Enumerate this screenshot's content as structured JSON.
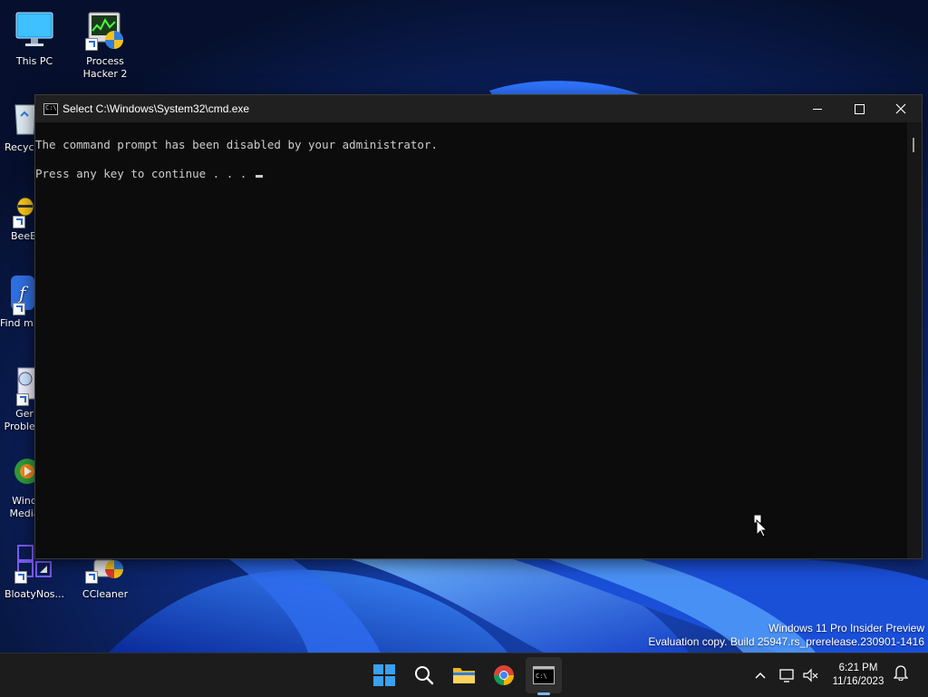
{
  "desktop": {
    "icons": [
      {
        "label": "This PC"
      },
      {
        "label": "Process Hacker 2"
      },
      {
        "label": "Recyc"
      },
      {
        "label": "BeeE"
      },
      {
        "label": "Find m"
      },
      {
        "label": "Ger Problem"
      },
      {
        "label": "Wind Media"
      },
      {
        "label": "BloatyNos..."
      },
      {
        "label": "CCleaner"
      }
    ]
  },
  "cmd": {
    "title": "Select C:\\Windows\\System32\\cmd.exe",
    "app_icon_text": "C:\\",
    "lines": [
      "The command prompt has been disabled by your administrator.",
      "Press any key to continue . . . "
    ]
  },
  "watermark": {
    "line1": "Windows 11 Pro Insider Preview",
    "line2": "Evaluation copy. Build 25947.rs_prerelease.230901-1416"
  },
  "taskbar": {
    "apps": [
      "start-icon",
      "search-icon",
      "file-explorer-icon",
      "chrome-icon",
      "cmd-icon"
    ],
    "time": "6:21 PM",
    "date": "11/16/2023"
  },
  "colors": {
    "cmd_bg": "#0c0c0c",
    "cmd_text": "#cccccc",
    "titlebar": "#202020",
    "taskbar": "#1c1c1c",
    "accent": "#7eb6f5"
  }
}
